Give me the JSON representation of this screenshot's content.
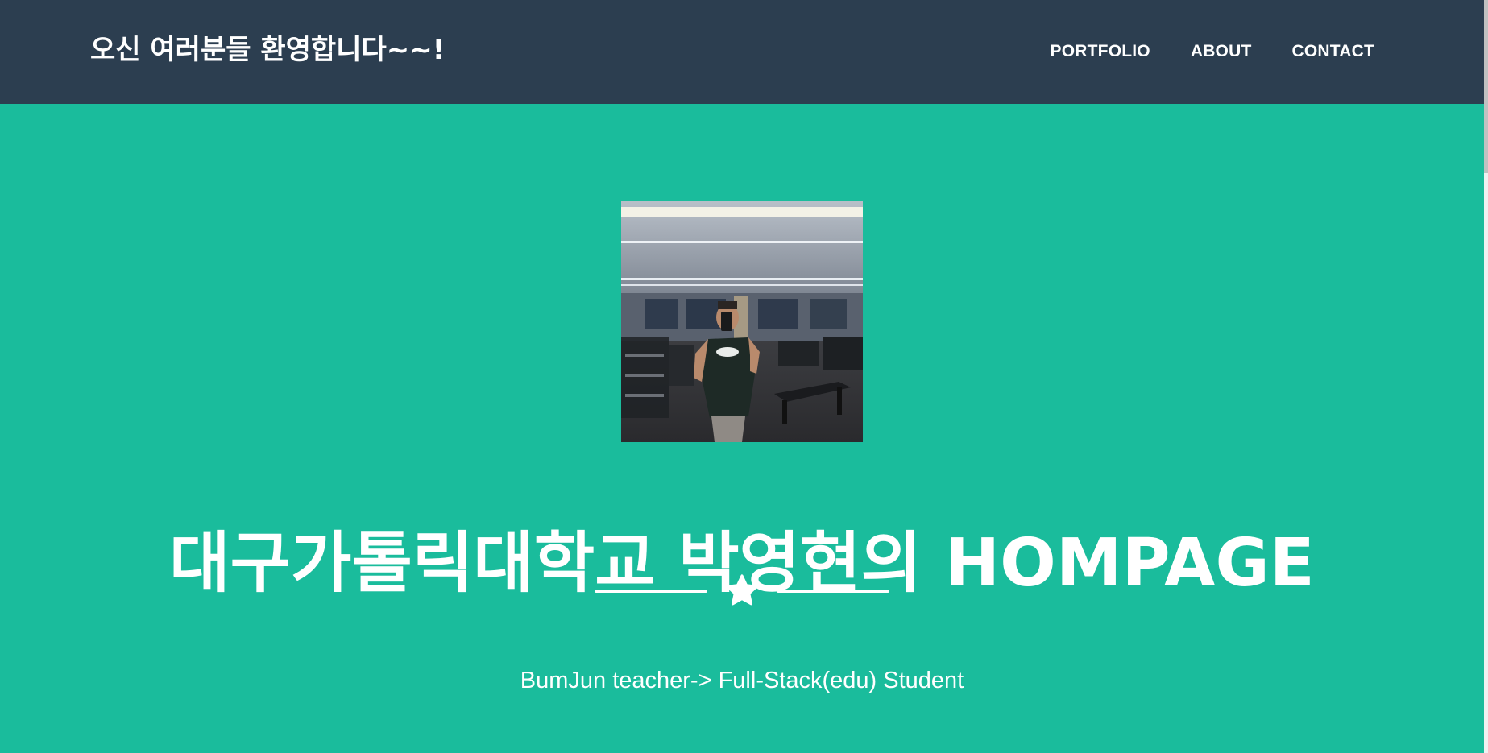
{
  "navbar": {
    "brand": "오신 여러분들 환영합니다~~!",
    "links": [
      "PORTFOLIO",
      "ABOUT",
      "CONTACT"
    ]
  },
  "masthead": {
    "avatar_alt": "Gym mirror selfie photo",
    "headline": "대구가톨릭대학교 박영현의 HOMPAGE",
    "divider_icon": "star-icon",
    "subheading": "BumJun teacher-> Full-Stack(edu) Student"
  },
  "colors": {
    "navbar_bg": "#2c3e50",
    "masthead_bg": "#1abc9c",
    "text": "#ffffff"
  }
}
